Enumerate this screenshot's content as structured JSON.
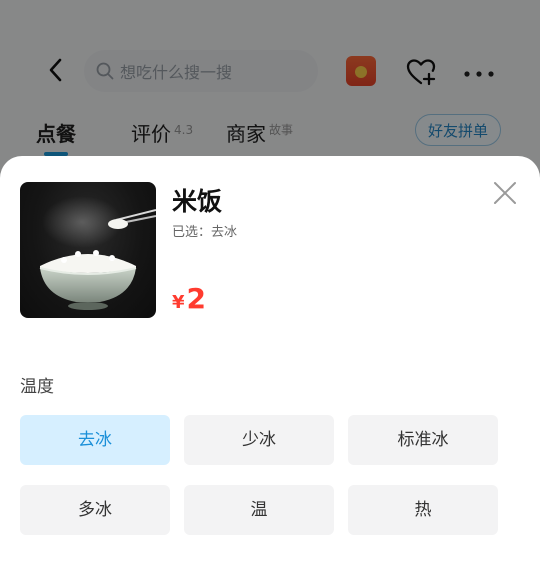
{
  "header": {
    "search_placeholder": "想吃什么搜一搜"
  },
  "tabs": [
    {
      "label": "点餐",
      "badge": ""
    },
    {
      "label": "评价",
      "badge": "4.3"
    },
    {
      "label": "商家",
      "badge": "故事"
    }
  ],
  "group_order_label": "好友拼单",
  "sheet": {
    "product_name": "米饭",
    "selected_prefix": "已选：",
    "selected_value": "去冰",
    "price_symbol": "¥",
    "price_value": "2",
    "section_label": "温度",
    "options": [
      {
        "label": "去冰",
        "selected": true
      },
      {
        "label": "少冰",
        "selected": false
      },
      {
        "label": "标准冰",
        "selected": false
      },
      {
        "label": "多冰",
        "selected": false
      },
      {
        "label": "温",
        "selected": false
      },
      {
        "label": "热",
        "selected": false
      }
    ]
  },
  "colors": {
    "accent": "#1a9cdc",
    "selected_bg": "#d6efff",
    "price": "#ff3b2f",
    "overlay": "rgba(0,0,0,0.45)"
  },
  "icons": {
    "back": "chevron-left-icon",
    "search": "search-icon",
    "red_packet": "red-packet-icon",
    "favorite": "heart-plus-icon",
    "more": "more-icon",
    "close": "close-icon"
  }
}
